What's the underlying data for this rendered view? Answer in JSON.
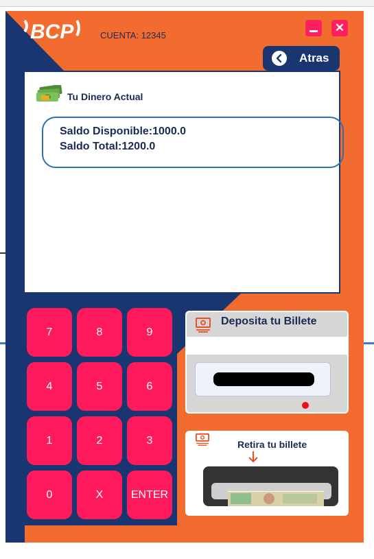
{
  "app": {
    "brand": "BCP",
    "account_label": "CUENTA: 12345"
  },
  "window_controls": {
    "minimize_icon": "minimize-icon",
    "close_icon": "close-icon",
    "close_glyph": "✕"
  },
  "nav": {
    "back_label": "Atras",
    "back_icon": "chevron-left-icon"
  },
  "balance": {
    "title": "Tu Dinero Actual",
    "icon": "money-icon",
    "available": "Saldo Disponible:1000.0",
    "total": "Saldo Total:1200.0"
  },
  "keypad": {
    "keys": [
      "7",
      "8",
      "9",
      "4",
      "5",
      "6",
      "1",
      "2",
      "3",
      "0",
      "X",
      "ENTER"
    ]
  },
  "deposit": {
    "title": "Deposita tu Billete",
    "icon": "cash-icon",
    "status_color": "#e8101a"
  },
  "withdraw": {
    "title": "Retira tu billete",
    "icon": "cash-icon",
    "arrow_icon": "arrow-down-icon"
  },
  "colors": {
    "orange": "#f26b2f",
    "navy": "#1a3671",
    "key_pink": "#ff1a5e",
    "text_navy": "#1b2a55"
  }
}
